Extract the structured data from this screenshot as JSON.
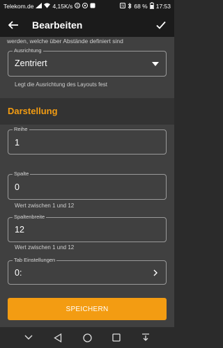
{
  "status_bar": {
    "carrier": "Telekom.de",
    "speed": "4,15K/s",
    "battery": "68 %",
    "time": "17:53",
    "icons": [
      "signal-icon",
      "wifi-icon",
      "skype-icon",
      "whatsapp-icon",
      "nfc-icon",
      "bluetooth-icon",
      "battery-icon"
    ]
  },
  "app_bar": {
    "title": "Bearbeiten",
    "back_icon": "arrow-left-icon",
    "confirm_icon": "check-icon"
  },
  "top_text": "werden, welche über Abstände definiert sind",
  "alignment_field": {
    "label": "Ausrichtung",
    "value": "Zentriert",
    "helper": "Legt die Ausrichtung des Layouts fest",
    "icon": "dropdown-icon"
  },
  "section": {
    "title": "Darstellung",
    "accent": "#f39c12"
  },
  "row_field": {
    "label": "Reihe",
    "value": "1"
  },
  "column_field": {
    "label": "Spalte",
    "value": "0",
    "helper": "Wert zwischen 1 und 12"
  },
  "column_width_field": {
    "label": "Spaltenbreite",
    "value": "12",
    "helper": "Wert zwischen 1 und 12"
  },
  "tab_settings_field": {
    "label": "Tab Einstellungen",
    "value": "0:",
    "icon": "chevron-right-icon"
  },
  "save_button": {
    "label": "SPEICHERN"
  },
  "nav_bar": {
    "icons": [
      "dropdown-arrow-icon",
      "back-triangle-icon",
      "home-circle-icon",
      "recents-square-icon",
      "notification-pull-icon"
    ]
  }
}
